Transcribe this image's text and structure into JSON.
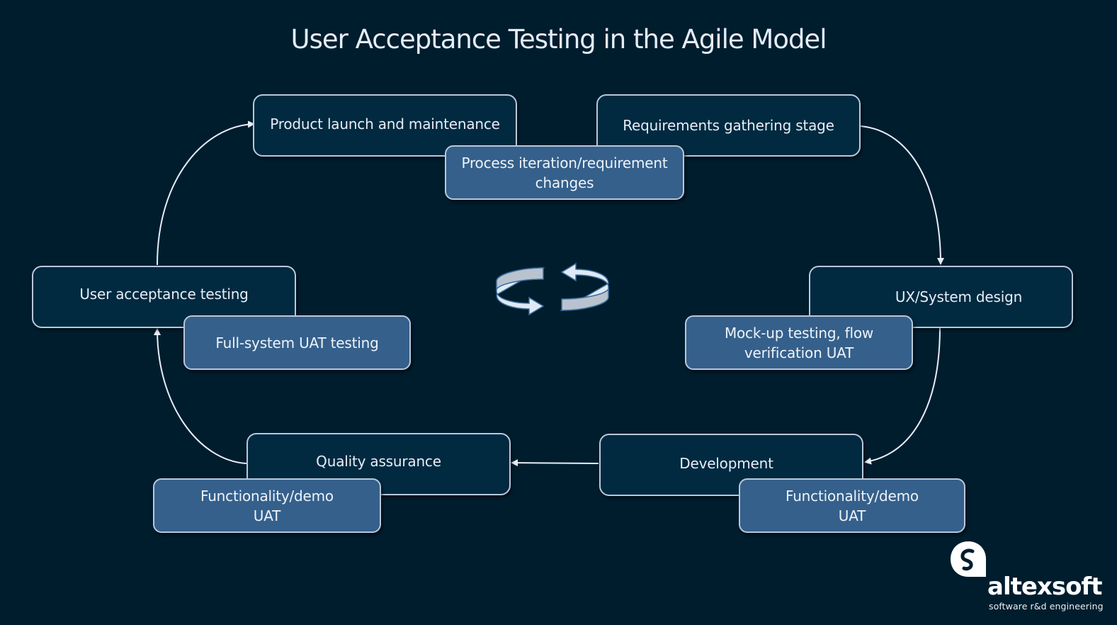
{
  "title": "User Acceptance Testing in the Agile Model",
  "colors": {
    "background": "#001d2e",
    "stage_fill": "#012a40",
    "sub_fill": "#35608b",
    "border": "#b7c9dc",
    "connector": "#e6eef7"
  },
  "stages": {
    "launch": "Product launch and maintenance",
    "requirements": "Requirements gathering stage",
    "design": "UX/System design",
    "development": "Development",
    "qa": "Quality assurance",
    "uat": "User acceptance testing"
  },
  "uat_activities": {
    "iteration": "Process iteration/requirement\nchanges",
    "mockup": "Mock-up testing, flow\nverification  UAT",
    "dev_demo": "Functionality/demo\nUAT",
    "qa_demo": "Functionality/demo\nUAT",
    "full_system": "Full-system UAT testing"
  },
  "flow": [
    {
      "from": "requirements",
      "to": "design"
    },
    {
      "from": "design",
      "to": "development"
    },
    {
      "from": "development",
      "to": "qa"
    },
    {
      "from": "qa",
      "to": "uat"
    },
    {
      "from": "uat",
      "to": "launch"
    }
  ],
  "center_icon": "cycle-arrows-icon",
  "logo": {
    "icon": "altexsoft-logo-icon",
    "name": "altexsoft",
    "tagline": "software r&d engineering"
  }
}
